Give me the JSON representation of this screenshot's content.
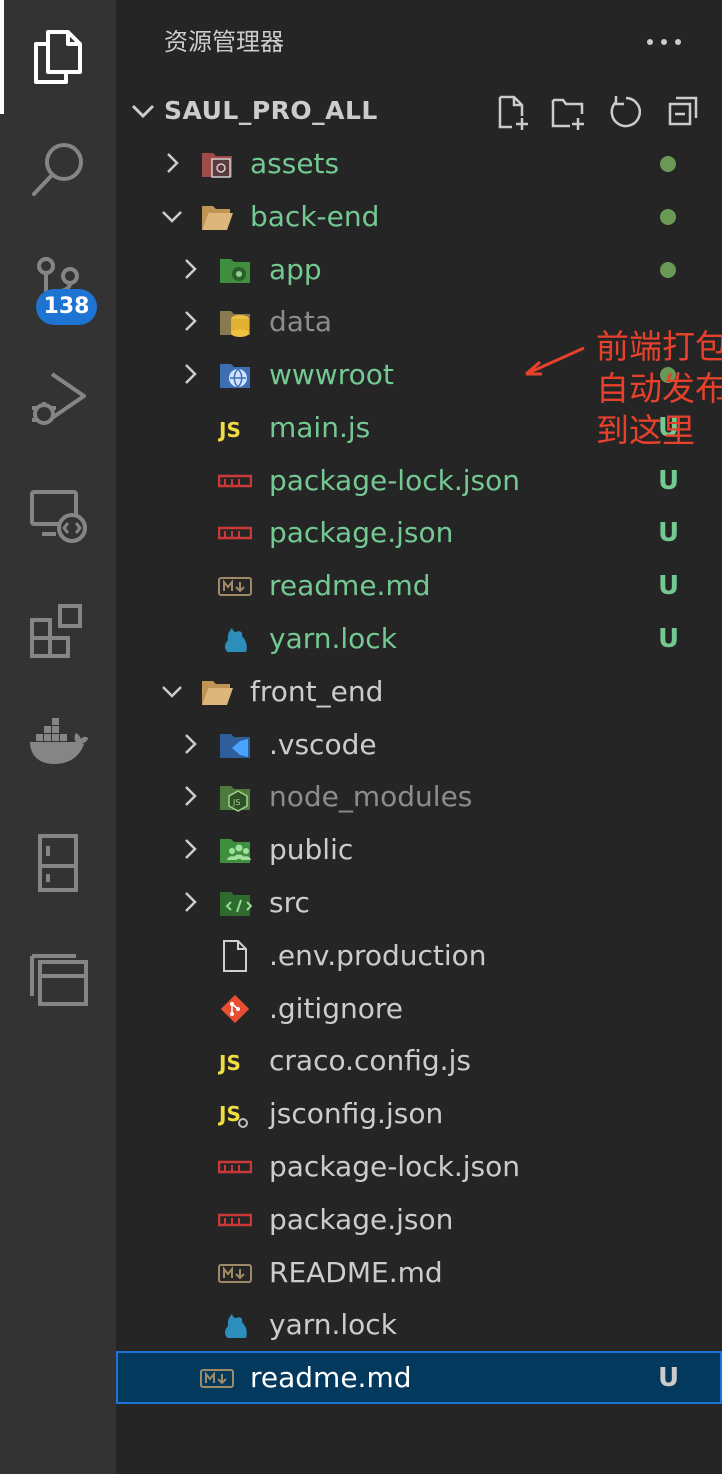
{
  "activity_bar": {
    "scm_badge": "138"
  },
  "explorer": {
    "title": "资源管理器",
    "root": "SAUL_PRO_ALL"
  },
  "tree": [
    {
      "label": "assets",
      "status": "dot"
    },
    {
      "label": "back-end",
      "status": "dot"
    },
    {
      "label": "app",
      "status": "dot"
    },
    {
      "label": "data",
      "status": ""
    },
    {
      "label": "wwwroot",
      "status": "dot"
    },
    {
      "label": "main.js",
      "status": "U"
    },
    {
      "label": "package-lock.json",
      "status": "U"
    },
    {
      "label": "package.json",
      "status": "U"
    },
    {
      "label": "readme.md",
      "status": "U"
    },
    {
      "label": "yarn.lock",
      "status": "U"
    },
    {
      "label": "front_end",
      "status": ""
    },
    {
      "label": ".vscode",
      "status": ""
    },
    {
      "label": "node_modules",
      "status": ""
    },
    {
      "label": "public",
      "status": ""
    },
    {
      "label": "src",
      "status": ""
    },
    {
      "label": ".env.production",
      "status": ""
    },
    {
      "label": ".gitignore",
      "status": ""
    },
    {
      "label": "craco.config.js",
      "status": ""
    },
    {
      "label": "jsconfig.json",
      "status": ""
    },
    {
      "label": "package-lock.json",
      "status": ""
    },
    {
      "label": "package.json",
      "status": ""
    },
    {
      "label": "README.md",
      "status": ""
    },
    {
      "label": "yarn.lock",
      "status": ""
    },
    {
      "label": "readme.md",
      "status": "U"
    }
  ],
  "annotation": {
    "line1": "前端打包",
    "line2": "自动发布",
    "line3": "到这里"
  },
  "colors": {
    "modified": "#73c991",
    "annotation": "#e8412b",
    "selection": "#04395e",
    "badge": "#1e74d2"
  }
}
